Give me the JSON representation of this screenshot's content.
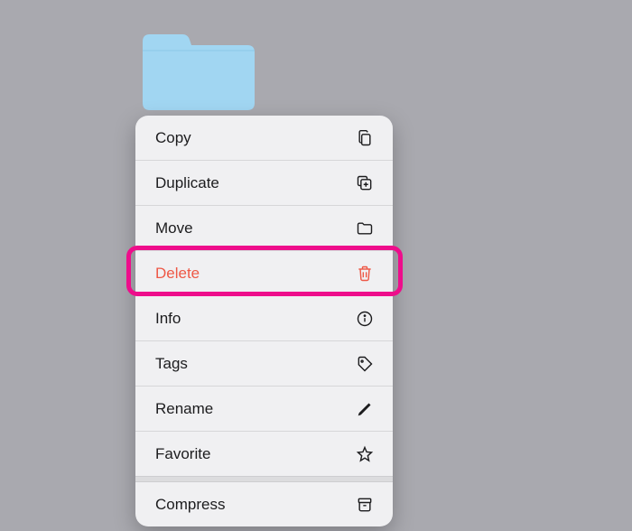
{
  "folder": {
    "color": "#a1d6f2"
  },
  "menu": {
    "items": [
      {
        "label": "Copy",
        "icon": "copy-icon",
        "danger": false
      },
      {
        "label": "Duplicate",
        "icon": "duplicate-icon",
        "danger": false
      },
      {
        "label": "Move",
        "icon": "folder-icon",
        "danger": false
      },
      {
        "label": "Delete",
        "icon": "trash-icon",
        "danger": true
      },
      {
        "label": "Info",
        "icon": "info-icon",
        "danger": false
      },
      {
        "label": "Tags",
        "icon": "tag-icon",
        "danger": false
      },
      {
        "label": "Rename",
        "icon": "pencil-icon",
        "danger": false
      },
      {
        "label": "Favorite",
        "icon": "star-icon",
        "danger": false
      },
      {
        "label": "Compress",
        "icon": "archive-icon",
        "danger": false
      }
    ]
  },
  "highlighted_item": "Delete"
}
